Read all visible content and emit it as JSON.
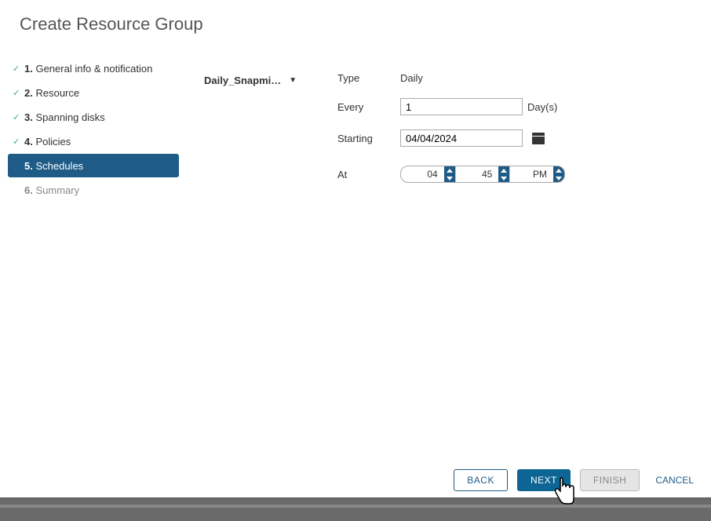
{
  "title": "Create Resource Group",
  "steps": [
    {
      "label": "General info & notification",
      "state": "done"
    },
    {
      "label": "Resource",
      "state": "done"
    },
    {
      "label": "Spanning disks",
      "state": "done"
    },
    {
      "label": "Policies",
      "state": "done"
    },
    {
      "label": "Schedules",
      "state": "active"
    },
    {
      "label": "Summary",
      "state": "pending"
    }
  ],
  "policy_dropdown": "Daily_Snapmi…",
  "form": {
    "type_label": "Type",
    "type_value": "Daily",
    "every_label": "Every",
    "every_value": "1",
    "every_unit": "Day(s)",
    "starting_label": "Starting",
    "starting_value": "04/04/2024",
    "at_label": "At",
    "hour": "04",
    "minute": "45",
    "ampm": "PM"
  },
  "buttons": {
    "back": "BACK",
    "next": "NEXT",
    "finish": "FINISH",
    "cancel": "CANCEL"
  }
}
